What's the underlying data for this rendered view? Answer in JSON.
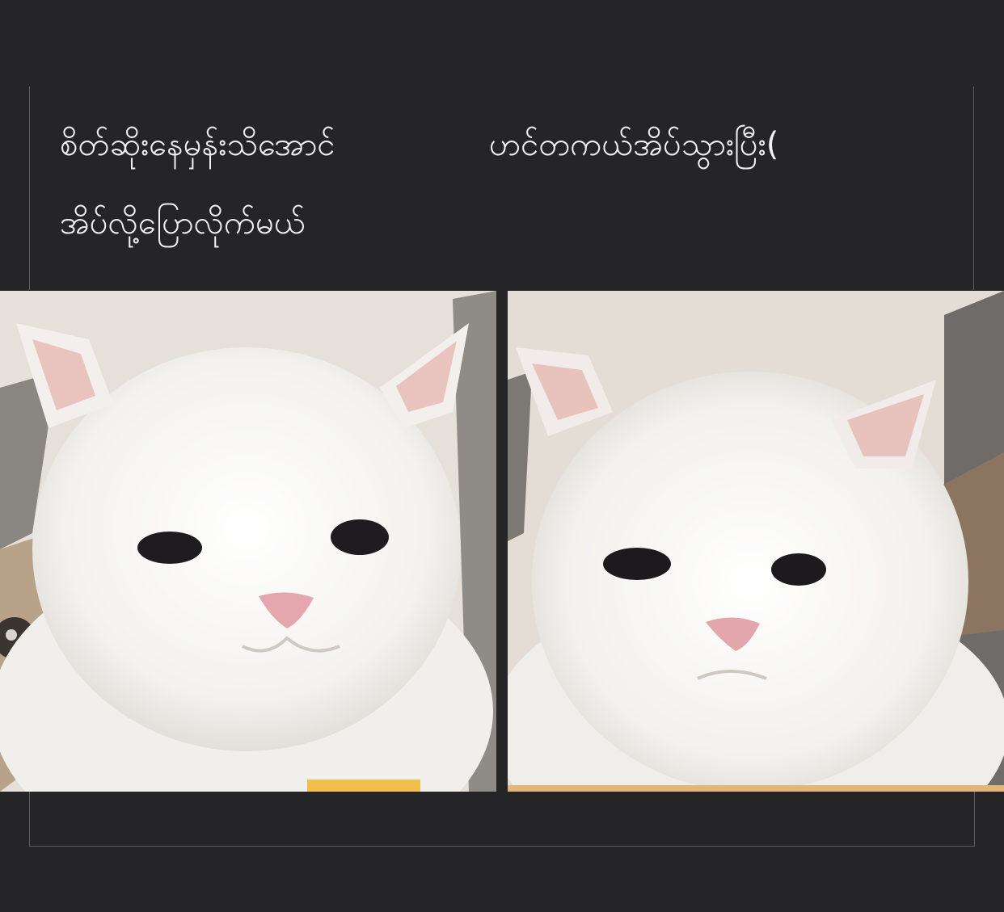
{
  "captions": {
    "left_line_1": "စိတ်ဆိုးနေမှန်းသိအောင်",
    "left_line_2": "အိပ်လို့ပြောလိုက်မယ်",
    "right_line_1": "ဟင်တကယ်အိပ်သွားပြီး("
  },
  "panels": [
    {
      "subject": "white-cat-smiling",
      "background": "#e8e2dc"
    },
    {
      "subject": "white-cat-frowning",
      "background": "#e4ddd6"
    }
  ]
}
